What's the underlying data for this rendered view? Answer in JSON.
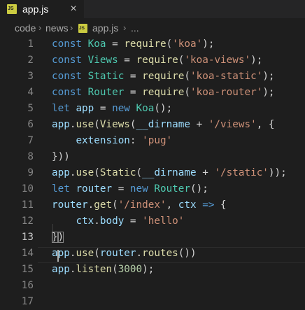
{
  "tab": {
    "title": "app.js",
    "badge": "JS",
    "close": "×"
  },
  "breadcrumb": {
    "items": [
      "code",
      "news",
      "app.js",
      "..."
    ],
    "separator": "›",
    "badge": "JS"
  },
  "editor": {
    "active_line": 13,
    "lines": [
      {
        "n": "1"
      },
      {
        "n": "2"
      },
      {
        "n": "3"
      },
      {
        "n": "4"
      },
      {
        "n": "5"
      },
      {
        "n": "6"
      },
      {
        "n": "7"
      },
      {
        "n": "8"
      },
      {
        "n": "9"
      },
      {
        "n": "10"
      },
      {
        "n": "11"
      },
      {
        "n": "12"
      },
      {
        "n": "13"
      },
      {
        "n": "14"
      },
      {
        "n": "15"
      },
      {
        "n": "16"
      },
      {
        "n": "17"
      }
    ],
    "tokens": [
      [
        [
          "k",
          "const"
        ],
        [
          "p",
          " "
        ],
        [
          "c",
          "Koa"
        ],
        [
          "p",
          " = "
        ],
        [
          "f",
          "require"
        ],
        [
          "p",
          "("
        ],
        [
          "s",
          "'koa'"
        ],
        [
          "p",
          ");"
        ]
      ],
      [
        [
          "k",
          "const"
        ],
        [
          "p",
          " "
        ],
        [
          "c",
          "Views"
        ],
        [
          "p",
          " = "
        ],
        [
          "f",
          "require"
        ],
        [
          "p",
          "("
        ],
        [
          "s",
          "'koa-views'"
        ],
        [
          "p",
          ");"
        ]
      ],
      [
        [
          "k",
          "const"
        ],
        [
          "p",
          " "
        ],
        [
          "c",
          "Static"
        ],
        [
          "p",
          " = "
        ],
        [
          "f",
          "require"
        ],
        [
          "p",
          "("
        ],
        [
          "s",
          "'koa-static'"
        ],
        [
          "p",
          ");"
        ]
      ],
      [
        [
          "k",
          "const"
        ],
        [
          "p",
          " "
        ],
        [
          "c",
          "Router"
        ],
        [
          "p",
          " = "
        ],
        [
          "f",
          "require"
        ],
        [
          "p",
          "("
        ],
        [
          "s",
          "'koa-router'"
        ],
        [
          "p",
          ");"
        ]
      ],
      [
        [
          "k",
          "let"
        ],
        [
          "p",
          " "
        ],
        [
          "v",
          "app"
        ],
        [
          "p",
          " = "
        ],
        [
          "k",
          "new"
        ],
        [
          "p",
          " "
        ],
        [
          "c",
          "Koa"
        ],
        [
          "p",
          "();"
        ]
      ],
      [
        [
          "v",
          "app"
        ],
        [
          "p",
          "."
        ],
        [
          "f",
          "use"
        ],
        [
          "p",
          "("
        ],
        [
          "f",
          "Views"
        ],
        [
          "p",
          "("
        ],
        [
          "v",
          "__dirname"
        ],
        [
          "p",
          " + "
        ],
        [
          "s",
          "'/views'"
        ],
        [
          "p",
          ", {"
        ]
      ],
      [
        [
          "p",
          "    "
        ],
        [
          "v",
          "extension"
        ],
        [
          "p",
          ": "
        ],
        [
          "s",
          "'pug'"
        ]
      ],
      [
        [
          "p",
          "}))"
        ]
      ],
      [
        [
          "v",
          "app"
        ],
        [
          "p",
          "."
        ],
        [
          "f",
          "use"
        ],
        [
          "p",
          "("
        ],
        [
          "f",
          "Static"
        ],
        [
          "p",
          "("
        ],
        [
          "v",
          "__dirname"
        ],
        [
          "p",
          " + "
        ],
        [
          "s",
          "'/static'"
        ],
        [
          "p",
          "));"
        ]
      ],
      [
        [
          "k",
          "let"
        ],
        [
          "p",
          " "
        ],
        [
          "v",
          "router"
        ],
        [
          "p",
          " = "
        ],
        [
          "k",
          "new"
        ],
        [
          "p",
          " "
        ],
        [
          "c",
          "Router"
        ],
        [
          "p",
          "();"
        ]
      ],
      [
        [
          "v",
          "router"
        ],
        [
          "p",
          "."
        ],
        [
          "f",
          "get"
        ],
        [
          "p",
          "("
        ],
        [
          "s",
          "'/index'"
        ],
        [
          "p",
          ", "
        ],
        [
          "v",
          "ctx"
        ],
        [
          "p",
          " "
        ],
        [
          "k",
          "=>"
        ],
        [
          "p",
          " {"
        ]
      ],
      [
        [
          "p",
          "    "
        ],
        [
          "v",
          "ctx"
        ],
        [
          "p",
          "."
        ],
        [
          "v",
          "body"
        ],
        [
          "p",
          " = "
        ],
        [
          "s",
          "'hello'"
        ]
      ],
      [
        [
          "bm",
          "}"
        ],
        [
          "bm",
          ")"
        ]
      ],
      [
        [
          "v",
          "app"
        ],
        [
          "p",
          "."
        ],
        [
          "f",
          "use"
        ],
        [
          "p",
          "("
        ],
        [
          "v",
          "router"
        ],
        [
          "p",
          "."
        ],
        [
          "f",
          "routes"
        ],
        [
          "p",
          "())"
        ]
      ],
      [
        [
          "v",
          "app"
        ],
        [
          "p",
          "."
        ],
        [
          "f",
          "listen"
        ],
        [
          "p",
          "("
        ],
        [
          "n",
          "3000"
        ],
        [
          "p",
          ");"
        ]
      ],
      [],
      []
    ]
  },
  "colors": {
    "background": "#1e1e1e",
    "keyword": "#569cd6",
    "variable": "#9cdcfe",
    "class": "#4ec9b0",
    "function": "#dcdcaa",
    "string": "#ce9178",
    "number": "#b5cea8"
  }
}
